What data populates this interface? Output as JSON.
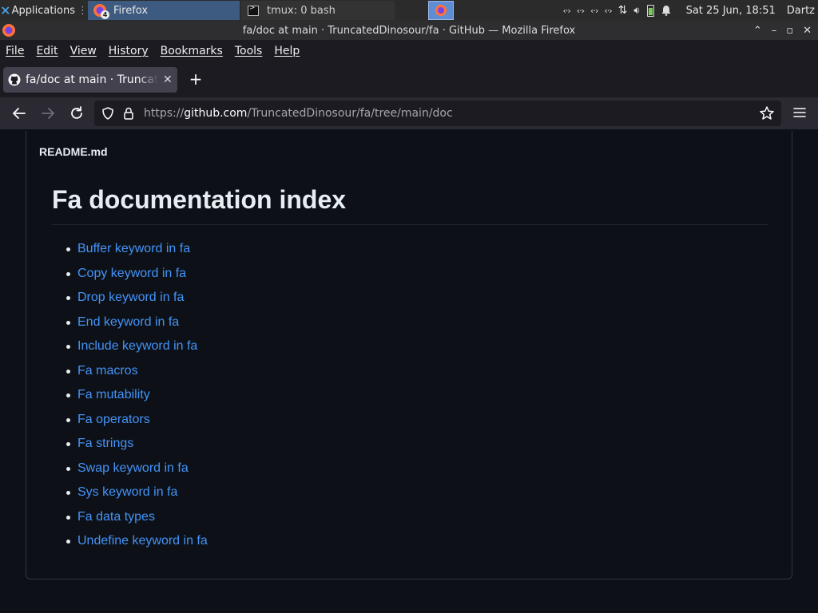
{
  "taskbar": {
    "applications_label": "Applications",
    "firefox_task_label": "Firefox",
    "firefox_badge": "4",
    "terminal_task_label": "tmux: 0 bash",
    "clock": "Sat 25 Jun, 18:51",
    "user": "Dartz"
  },
  "window": {
    "title": "fa/doc at main · TruncatedDinosour/fa · GitHub — Mozilla Firefox"
  },
  "menubar": {
    "items": [
      "File",
      "Edit",
      "View",
      "History",
      "Bookmarks",
      "Tools",
      "Help"
    ]
  },
  "tabs": [
    {
      "label": "fa/doc at main · TruncatedDinosour/fa"
    }
  ],
  "urlbar": {
    "scheme": "https://",
    "host": "github.com",
    "path": "/TruncatedDinosour/fa/tree/main/doc"
  },
  "readme": {
    "filename": "README.md",
    "title": "Fa documentation index",
    "links": [
      "Buffer keyword in fa",
      "Copy keyword in fa",
      "Drop keyword in fa",
      "End keyword in fa",
      "Include keyword in fa",
      "Fa macros",
      "Fa mutability",
      "Fa operators",
      "Fa strings",
      "Swap keyword in fa",
      "Sys keyword in fa",
      "Fa data types",
      "Undefine keyword in fa"
    ]
  },
  "colors": {
    "page_bg": "#0d1117",
    "link": "#4493f8",
    "text": "#e6edf3",
    "border": "#30363d"
  }
}
